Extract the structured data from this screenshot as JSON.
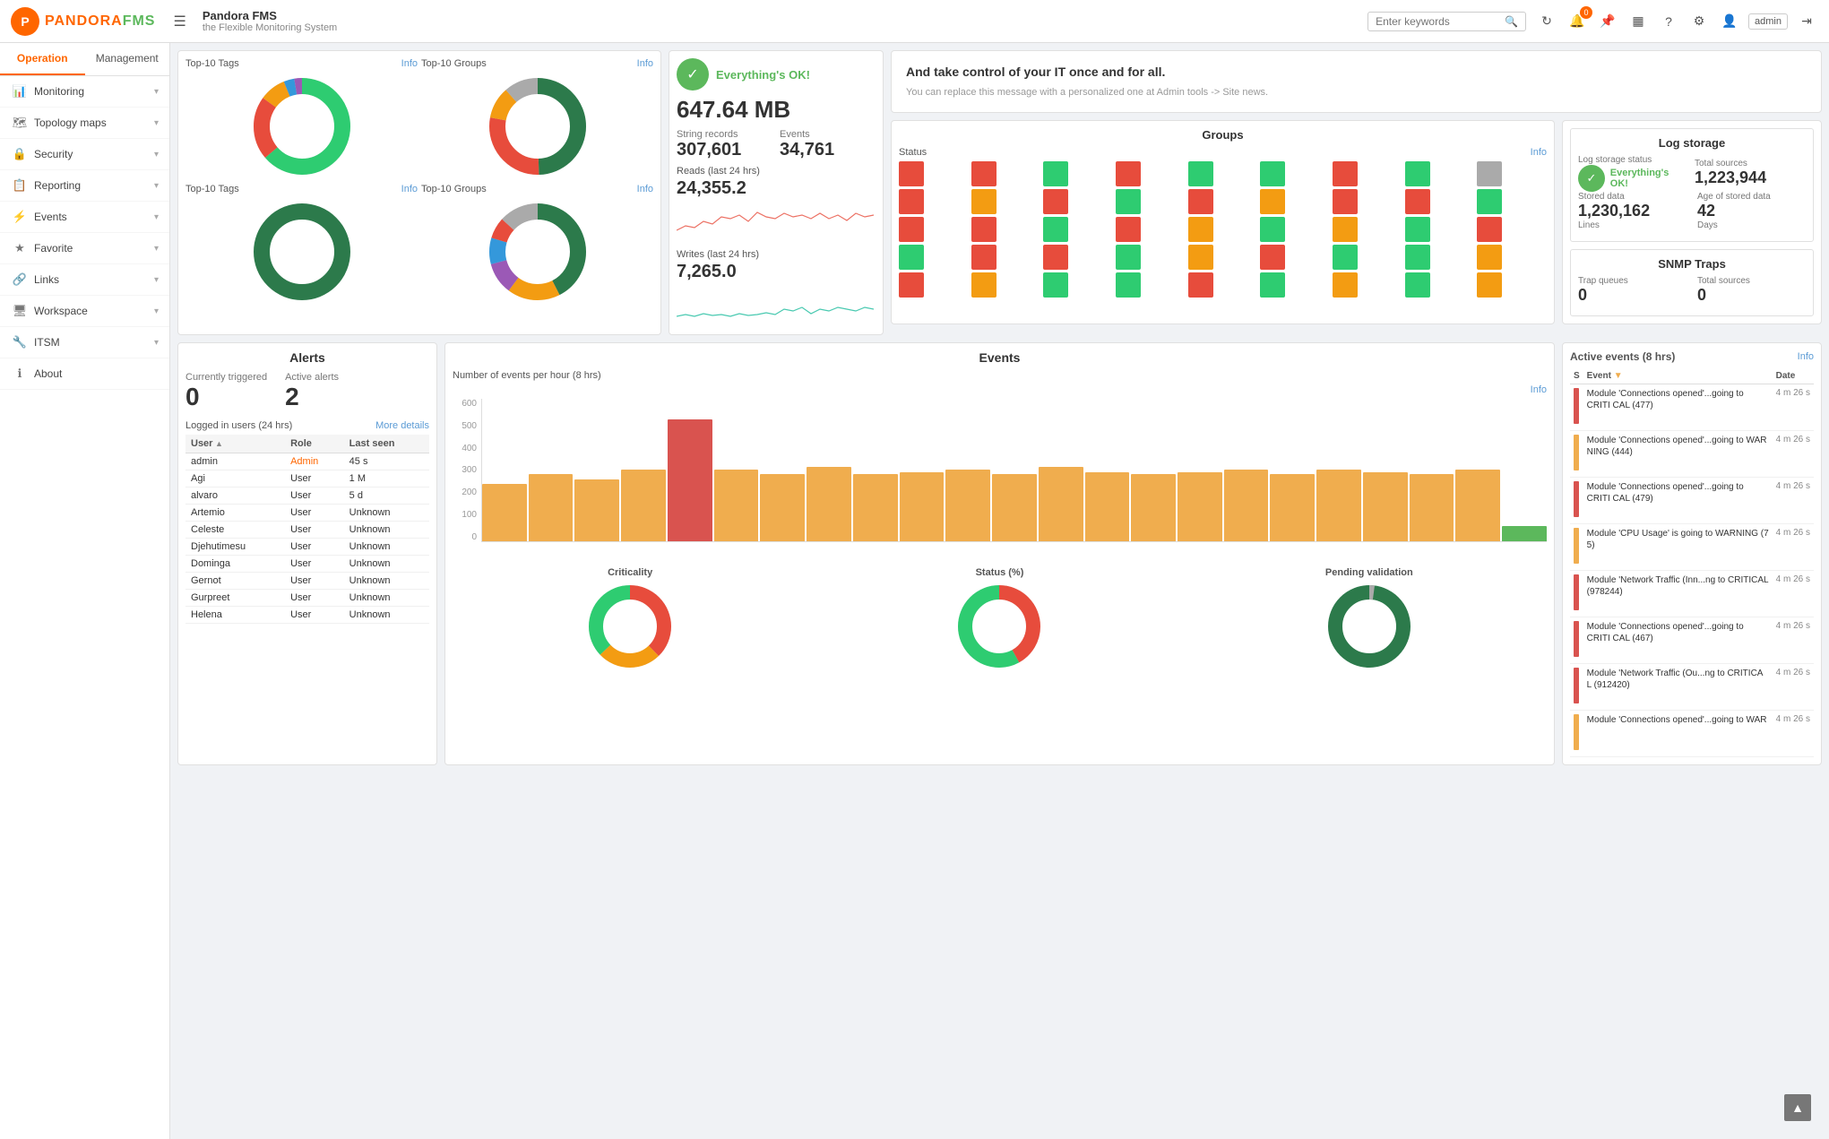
{
  "topbar": {
    "logo_text": "PANDORA",
    "logo_fms": "FMS",
    "main_title": "Pandora FMS",
    "sub_title": "the Flexible Monitoring System",
    "search_placeholder": "Enter keywords",
    "admin_label": "admin",
    "badge_count": "0"
  },
  "sidebar": {
    "tab_operation": "Operation",
    "tab_management": "Management",
    "items": [
      {
        "id": "monitoring",
        "label": "Monitoring",
        "icon": "📊"
      },
      {
        "id": "topology",
        "label": "Topology maps",
        "icon": "🗺"
      },
      {
        "id": "security",
        "label": "Security",
        "icon": "🔒"
      },
      {
        "id": "reporting",
        "label": "Reporting",
        "icon": "📋"
      },
      {
        "id": "events",
        "label": "Events",
        "icon": "⚡"
      },
      {
        "id": "favorite",
        "label": "Favorite",
        "icon": "★"
      },
      {
        "id": "links",
        "label": "Links",
        "icon": "🔗"
      },
      {
        "id": "workspace",
        "label": "Workspace",
        "icon": "🖥"
      },
      {
        "id": "itsm",
        "label": "ITSM",
        "icon": "🔧"
      },
      {
        "id": "about",
        "label": "About",
        "icon": "ℹ"
      }
    ]
  },
  "top_widgets": {
    "donut1_label": "Top-10 Tags",
    "donut2_label": "Top-10 Groups",
    "info": "Info"
  },
  "stats": {
    "ok_label": "Everything's OK!",
    "storage_value": "647.64 MB",
    "string_records_label": "String records",
    "string_records_value": "307,601",
    "events_label": "Events",
    "events_value": "34,761",
    "reads_label": "Reads (last 24 hrs)",
    "reads_value": "24,355.2",
    "writes_label": "Writes (last 24 hrs)",
    "writes_value": "7,265.0"
  },
  "welcome": {
    "tagline": "And take control of your IT once and for all.",
    "note": "You can replace this message with a personalized one at Admin tools -> Site news."
  },
  "groups": {
    "title": "Groups",
    "status_label": "Status",
    "info": "Info"
  },
  "log_storage": {
    "title": "Log storage",
    "status_label": "Log storage status",
    "ok_label": "Everything's OK!",
    "total_sources_label": "Total sources",
    "total_sources_value": "1,223,944",
    "stored_data_label": "Stored data",
    "stored_data_value": "1,230,162",
    "stored_data_unit": "Lines",
    "age_label": "Age of stored data",
    "age_value": "42",
    "age_unit": "Days"
  },
  "snmp": {
    "title": "SNMP Traps",
    "trap_queues_label": "Trap queues",
    "trap_queues_value": "0",
    "total_sources_label": "Total sources",
    "total_sources_value": "0"
  },
  "alerts": {
    "title": "Alerts",
    "triggered_label": "Currently triggered",
    "triggered_value": "0",
    "active_label": "Active alerts",
    "active_value": "2",
    "users_title": "Logged in users (24 hrs)",
    "more_details": "More details",
    "table_headers": [
      "User",
      "Role",
      "Last seen"
    ],
    "users": [
      {
        "user": "admin",
        "role": "Admin",
        "role_type": "admin",
        "last_seen": "45 s"
      },
      {
        "user": "Agi",
        "role": "User",
        "role_type": "user",
        "last_seen": "1 M"
      },
      {
        "user": "alvaro",
        "role": "User",
        "role_type": "user",
        "last_seen": "5 d"
      },
      {
        "user": "Artemio",
        "role": "User",
        "role_type": "user",
        "last_seen": "Unknown"
      },
      {
        "user": "Celeste",
        "role": "User",
        "role_type": "user",
        "last_seen": "Unknown"
      },
      {
        "user": "Djehutimesu",
        "role": "User",
        "role_type": "user",
        "last_seen": "Unknown"
      },
      {
        "user": "Dominga",
        "role": "User",
        "role_type": "user",
        "last_seen": "Unknown"
      },
      {
        "user": "Gernot",
        "role": "User",
        "role_type": "user",
        "last_seen": "Unknown"
      },
      {
        "user": "Gurpreet",
        "role": "User",
        "role_type": "user",
        "last_seen": "Unknown"
      },
      {
        "user": "Helena",
        "role": "User",
        "role_type": "user",
        "last_seen": "Unknown"
      }
    ]
  },
  "events": {
    "title": "Events",
    "chart_title": "Number of events per hour (8 hrs)",
    "info": "Info",
    "y_axis": [
      "0",
      "100",
      "200",
      "300",
      "400",
      "500",
      "600"
    ],
    "bars": [
      240,
      280,
      260,
      300,
      510,
      300,
      280,
      310,
      280,
      290,
      300,
      280,
      310,
      290,
      280,
      290,
      300,
      280,
      300,
      290,
      280,
      300,
      65
    ],
    "bar_colors": [
      "#f0ad4e",
      "#f0ad4e",
      "#f0ad4e",
      "#f0ad4e",
      "#d9534f",
      "#f0ad4e",
      "#f0ad4e",
      "#f0ad4e",
      "#f0ad4e",
      "#f0ad4e",
      "#f0ad4e",
      "#f0ad4e",
      "#f0ad4e",
      "#f0ad4e",
      "#f0ad4e",
      "#f0ad4e",
      "#f0ad4e",
      "#f0ad4e",
      "#f0ad4e",
      "#f0ad4e",
      "#f0ad4e",
      "#f0ad4e",
      "#5cb85c"
    ],
    "donut_criticality": "Criticality",
    "donut_status": "Status (%)",
    "donut_pending": "Pending validation"
  },
  "active_events": {
    "title": "Active events (8 hrs)",
    "info": "Info",
    "headers": [
      "S",
      "Event",
      "Date"
    ],
    "events": [
      {
        "severity": "critical",
        "text": "Module 'Connections opened'...going to CRITI CAL (477)",
        "time": "4 m 26 s"
      },
      {
        "severity": "warning",
        "text": "Module 'Connections opened'...going to WAR NING (444)",
        "time": "4 m 26 s"
      },
      {
        "severity": "critical",
        "text": "Module 'Connections opened'...going to CRITI CAL (479)",
        "time": "4 m 26 s"
      },
      {
        "severity": "warning",
        "text": "Module 'CPU Usage' is going to WARNING (7 5)",
        "time": "4 m 26 s"
      },
      {
        "severity": "critical",
        "text": "Module 'Network Traffic (Inn...ng to CRITICAL (978244)",
        "time": "4 m 26 s"
      },
      {
        "severity": "critical",
        "text": "Module 'Connections opened'...going to CRITI CAL (467)",
        "time": "4 m 26 s"
      },
      {
        "severity": "critical",
        "text": "Module 'Network Traffic (Ou...ng to CRITICA L (912420)",
        "time": "4 m 26 s"
      },
      {
        "severity": "warning",
        "text": "Module 'Connections opened'...going to WAR",
        "time": "4 m 26 s"
      }
    ]
  }
}
